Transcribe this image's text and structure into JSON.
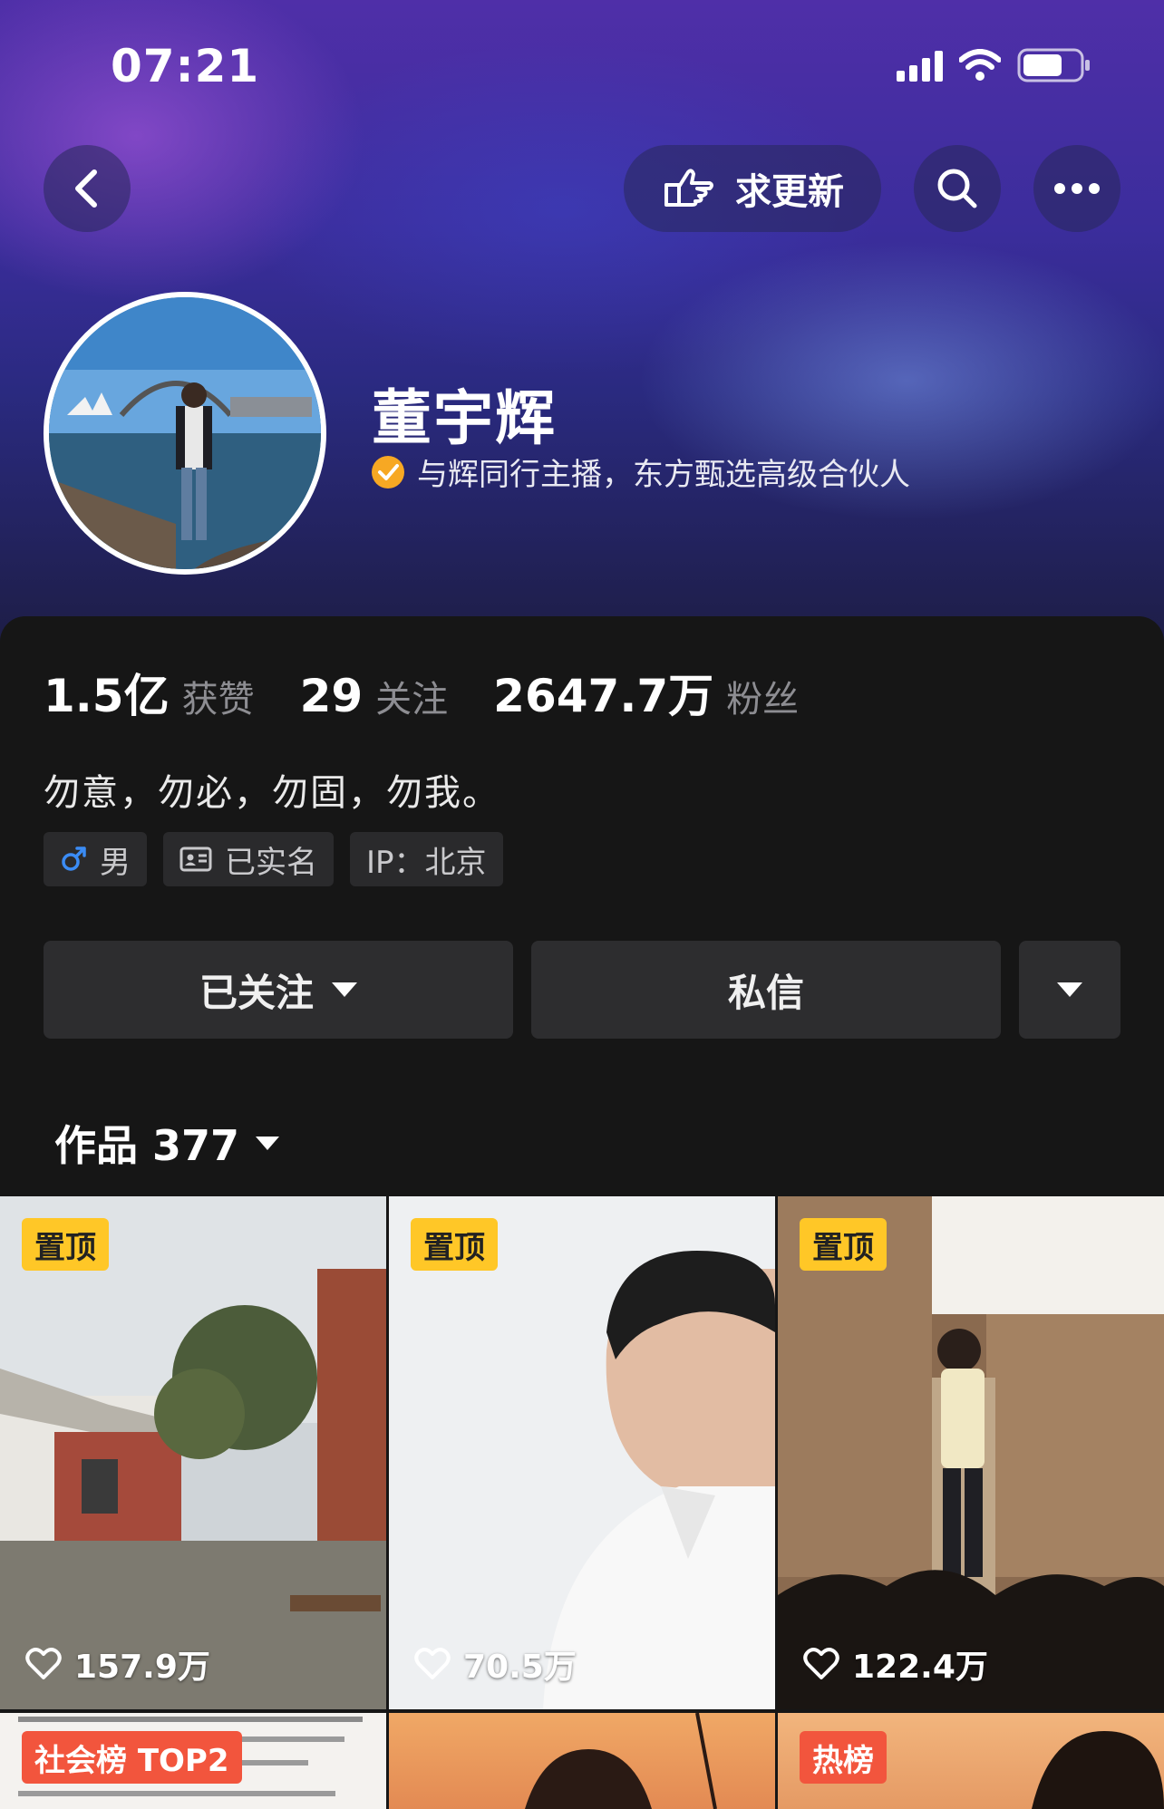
{
  "status_bar": {
    "time": "07:21"
  },
  "nav": {
    "update_label": "求更新"
  },
  "profile": {
    "name": "董宇辉",
    "verify_text": "与辉同行主播，东方甄选高级合伙人"
  },
  "stats": [
    {
      "value": "1.5亿",
      "label": "获赞"
    },
    {
      "value": "29",
      "label": "关注"
    },
    {
      "value": "2647.7万",
      "label": "粉丝"
    }
  ],
  "bio": "勿意，勿必，勿固，勿我。",
  "tags": {
    "gender": "男",
    "realname": "已实名",
    "ip": "IP：北京"
  },
  "actions": {
    "follow": "已关注",
    "message": "私信"
  },
  "works": {
    "label": "作品 377"
  },
  "grid": {
    "tiles": [
      {
        "badge": "置顶",
        "likes": "157.9万"
      },
      {
        "badge": "置顶",
        "likes": "70.5万"
      },
      {
        "badge": "置顶",
        "likes": "122.4万"
      }
    ],
    "row2": [
      {
        "badge": "社会榜 TOP2"
      },
      {
        "badge": ""
      },
      {
        "badge": "热榜"
      }
    ]
  },
  "colors": {
    "accent_yellow": "#ffc727",
    "badge_red": "#f2553d",
    "verify": "#f7a823"
  }
}
